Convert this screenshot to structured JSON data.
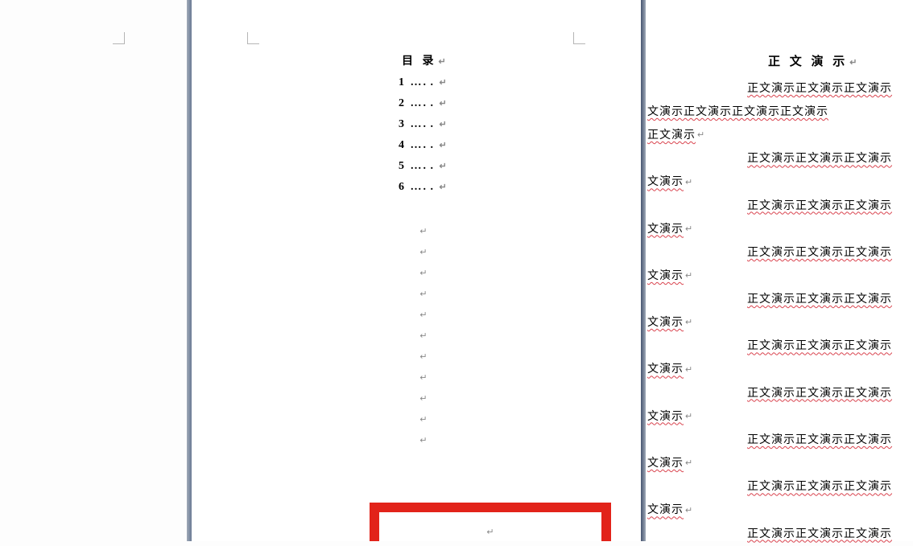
{
  "page1": {
    "toc_title": "目 录",
    "toc": [
      {
        "num": "1",
        "dots": "…",
        "suffix": ". ."
      },
      {
        "num": "2",
        "dots": "…",
        "suffix": ". ."
      },
      {
        "num": "3",
        "dots": "…",
        "suffix": ". ."
      },
      {
        "num": "4",
        "dots": "…",
        "suffix": ". ."
      },
      {
        "num": "5",
        "dots": "…",
        "suffix": ". ."
      },
      {
        "num": "6",
        "dots": "…",
        "suffix": ". ."
      }
    ],
    "pilcrow": "↵",
    "blank_count": 11
  },
  "page2": {
    "title": "正 文 演 示",
    "para_plain": "正文演示正文演示正文演示正文演示正文演示正文演示正文演示正文演示",
    "para_plain_wrap1": "正文演示正文演示正文演示",
    "para_plain_wrap2a": "文演示正文演示正文演示正文演示",
    "para_plain_wrap2b": "正文演示",
    "para_first": "正文演示正文演示正文演示",
    "para_wrap": "文演示",
    "para_count": 9,
    "last_first": "正文演示正文演示正文演示"
  }
}
